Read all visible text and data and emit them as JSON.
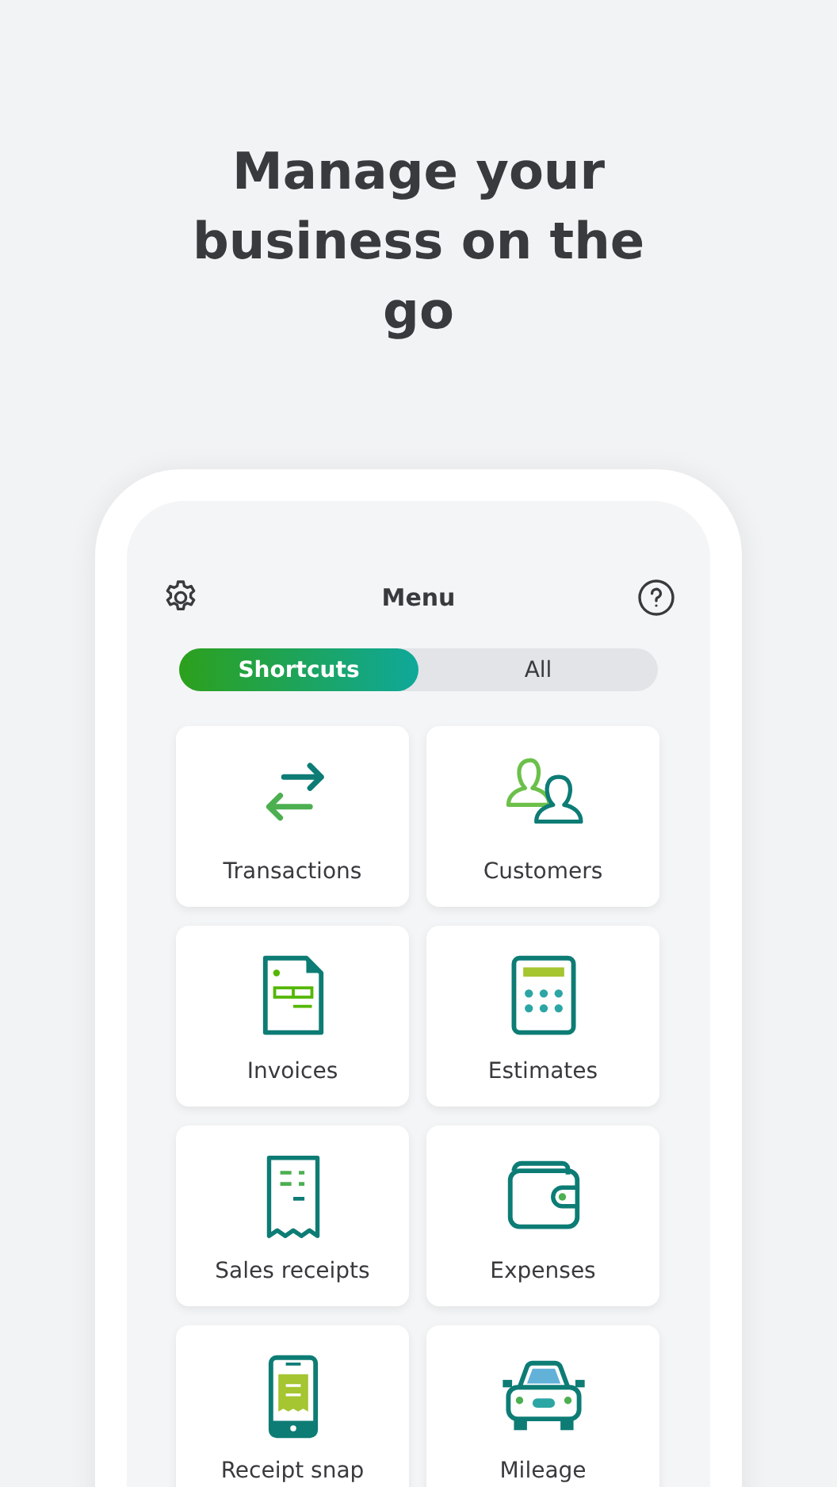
{
  "headline": "Manage your business on the go",
  "menu_bar": {
    "title": "Menu"
  },
  "segments": [
    {
      "label": "Shortcuts",
      "selected": true
    },
    {
      "label": "All",
      "selected": false
    }
  ],
  "shortcuts": [
    {
      "label": "Transactions",
      "kind": "transactions"
    },
    {
      "label": "Customers",
      "kind": "customers"
    },
    {
      "label": "Invoices",
      "kind": "invoices"
    },
    {
      "label": "Estimates",
      "kind": "estimates"
    },
    {
      "label": "Sales receipts",
      "kind": "receipts"
    },
    {
      "label": "Expenses",
      "kind": "expenses"
    },
    {
      "label": "Receipt snap",
      "kind": "snap"
    },
    {
      "label": "Mileage",
      "kind": "mileage"
    }
  ]
}
